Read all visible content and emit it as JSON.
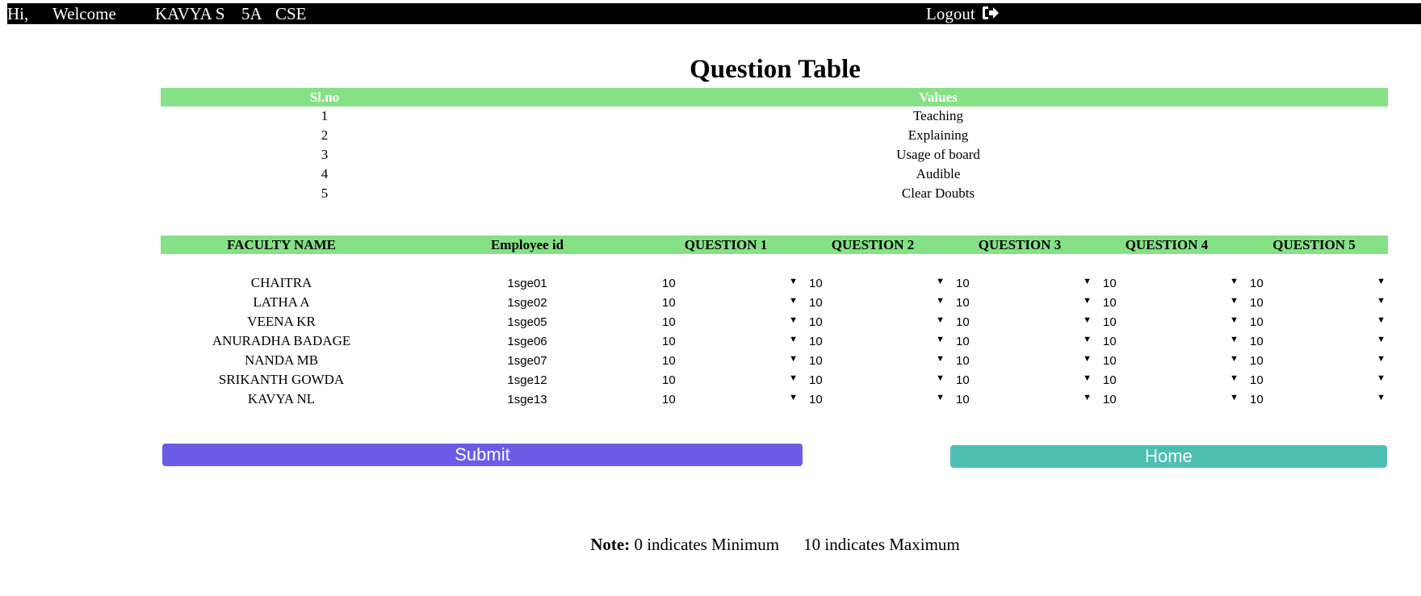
{
  "header": {
    "greeting": "Hi,",
    "welcome": "Welcome",
    "user_name": "KAVYA S",
    "section": "5A",
    "department": "CSE",
    "logout_label": "Logout"
  },
  "page_title": "Question Table",
  "question_table": {
    "columns": [
      "Sl.no",
      "Values"
    ],
    "rows": [
      {
        "slno": "1",
        "value": "Teaching"
      },
      {
        "slno": "2",
        "value": "Explaining"
      },
      {
        "slno": "3",
        "value": "Usage of board"
      },
      {
        "slno": "4",
        "value": "Audible"
      },
      {
        "slno": "5",
        "value": "Clear Doubts"
      }
    ]
  },
  "faculty_table": {
    "columns": [
      "FACULTY NAME",
      "Employee id",
      "QUESTION 1",
      "QUESTION 2",
      "QUESTION 3",
      "QUESTION 4",
      "QUESTION 5"
    ],
    "rows": [
      {
        "name": "CHAITRA",
        "emp_id": "1sge01",
        "scores": [
          "10",
          "10",
          "10",
          "10",
          "10"
        ]
      },
      {
        "name": "LATHA A",
        "emp_id": "1sge02",
        "scores": [
          "10",
          "10",
          "10",
          "10",
          "10"
        ]
      },
      {
        "name": "VEENA KR",
        "emp_id": "1sge05",
        "scores": [
          "10",
          "10",
          "10",
          "10",
          "10"
        ]
      },
      {
        "name": "ANURADHA BADAGE",
        "emp_id": "1sge06",
        "scores": [
          "10",
          "10",
          "10",
          "10",
          "10"
        ]
      },
      {
        "name": "NANDA MB",
        "emp_id": "1sge07",
        "scores": [
          "10",
          "10",
          "10",
          "10",
          "10"
        ]
      },
      {
        "name": "SRIKANTH GOWDA",
        "emp_id": "1sge12",
        "scores": [
          "10",
          "10",
          "10",
          "10",
          "10"
        ]
      },
      {
        "name": "KAVYA NL",
        "emp_id": "1sge13",
        "scores": [
          "10",
          "10",
          "10",
          "10",
          "10"
        ]
      }
    ]
  },
  "buttons": {
    "submit_label": "Submit",
    "home_label": "Home",
    "submit_color": "#6b5ce7",
    "home_color": "#4dbfb2"
  },
  "note": {
    "label": "Note:",
    "min_text": "0 indicates Minimum",
    "max_text": "10 indicates Maximum"
  },
  "colors": {
    "header_bar": "#000000",
    "table_header": "#86e186"
  }
}
